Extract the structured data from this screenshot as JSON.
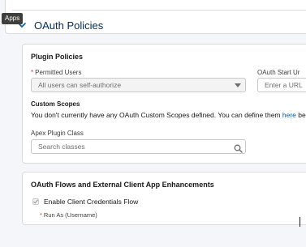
{
  "tooltip": {
    "label": "Apps"
  },
  "oauth_policies": {
    "title": "OAuth Policies"
  },
  "plugin_policies": {
    "title": "Plugin Policies",
    "permitted_users": {
      "required_marker": "*",
      "label": "Permitted Users",
      "value": "All users can self-authorize"
    },
    "oauth_start_url": {
      "label": "OAuth Start Ur",
      "placeholder": "Enter a URL"
    },
    "custom_scopes": {
      "label": "Custom Scopes",
      "text_before_link": "You don't currently have any OAuth Custom Scopes defined. You can define them ",
      "link_text": "here",
      "text_after_link": " be"
    },
    "apex_plugin_class": {
      "label": "Apex Plugin Class",
      "placeholder": "Search classes"
    }
  },
  "oauth_flows": {
    "title": "OAuth Flows and External Client App Enhancements",
    "client_credentials": {
      "label": "Enable Client Credentials Flow",
      "checked": true
    },
    "run_as": {
      "required_marker": "*",
      "label": "Run As (Username)"
    }
  },
  "icons": {
    "section_toggle": "chevron-down-icon",
    "dropdown": "caret-down-icon",
    "search": "search-icon",
    "checkbox": "checkmark-icon"
  },
  "colors": {
    "section_title": "#032d60",
    "link": "#0b5cab",
    "required": "#c23934",
    "tooltip_bg": "#3e3e3c"
  }
}
